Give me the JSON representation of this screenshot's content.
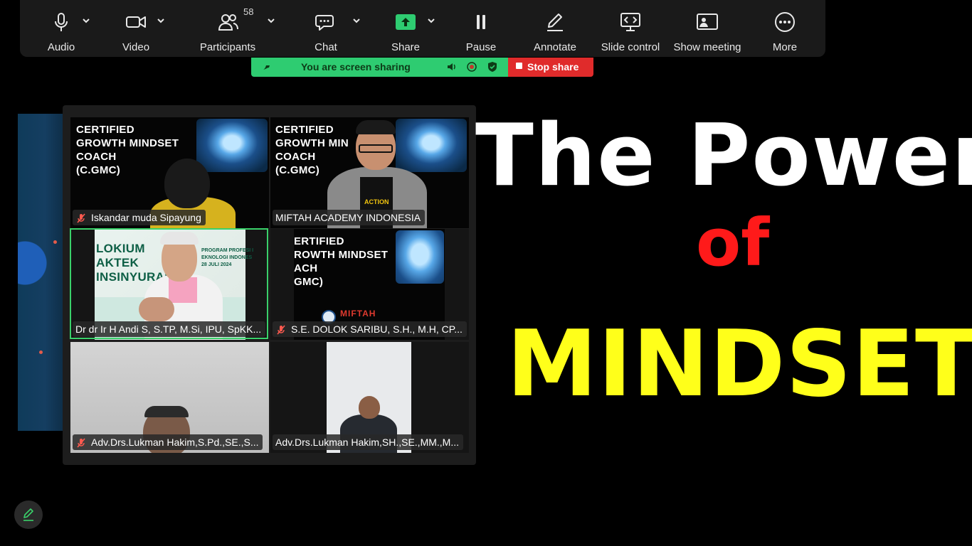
{
  "toolbar": {
    "audio": "Audio",
    "video": "Video",
    "participants": "Participants",
    "participants_count": "58",
    "chat": "Chat",
    "share": "Share",
    "pause": "Pause",
    "annotate": "Annotate",
    "slide_control": "Slide control",
    "show_meeting": "Show meeting",
    "more": "More"
  },
  "share_banner": {
    "text": "You are screen sharing",
    "stop_label": "Stop share"
  },
  "gallery": {
    "tiles": [
      {
        "name": "Iskandar muda Sipayung",
        "muted": true,
        "slide_lines": [
          "CERTIFIED",
          "GROWTH MINDSET",
          "COACH",
          "(C.GMC)"
        ]
      },
      {
        "name": "MIFTAH ACADEMY INDONESIA",
        "muted": false,
        "slide_lines": [
          "CERTIFIED",
          "GROWTH MIN",
          "COACH",
          "(C.GMC)"
        ],
        "shirt_text": "ACTION"
      },
      {
        "name": "Dr dr Ir H Andi S, S.TP, M.Si, IPU, SpKK...",
        "muted": false,
        "banner_lines": [
          "LOKIUM",
          "AKTEK",
          "INSINYURAN"
        ],
        "banner_right": [
          "PROGRAM PROFESI I",
          "EKNOLOGI INDONES",
          "28 JULI 2024"
        ]
      },
      {
        "name": "S.E. DOLOK SARIBU, S.H., M.H, CP...",
        "muted": true,
        "slide_lines": [
          "ERTIFIED",
          "ROWTH MINDSET",
          "ACH",
          "GMC)"
        ],
        "footer_text": "MIFTAH"
      },
      {
        "name": "Adv.Drs.Lukman Hakim,S.Pd.,SE.,S...",
        "muted": true
      },
      {
        "name": "Adv.Drs.Lukman Hakim,SH.,SE.,MM.,M...",
        "muted": false
      }
    ]
  },
  "slide": {
    "line1": "The Power",
    "line2": "of",
    "line3": "MINDSET"
  },
  "colors": {
    "share_green": "#2ecc71",
    "stop_red": "#e02b2b",
    "active_speaker": "#3ad16a",
    "title_white": "#ffffff",
    "title_red": "#ff1a1a",
    "title_yellow": "#ffff1a"
  }
}
